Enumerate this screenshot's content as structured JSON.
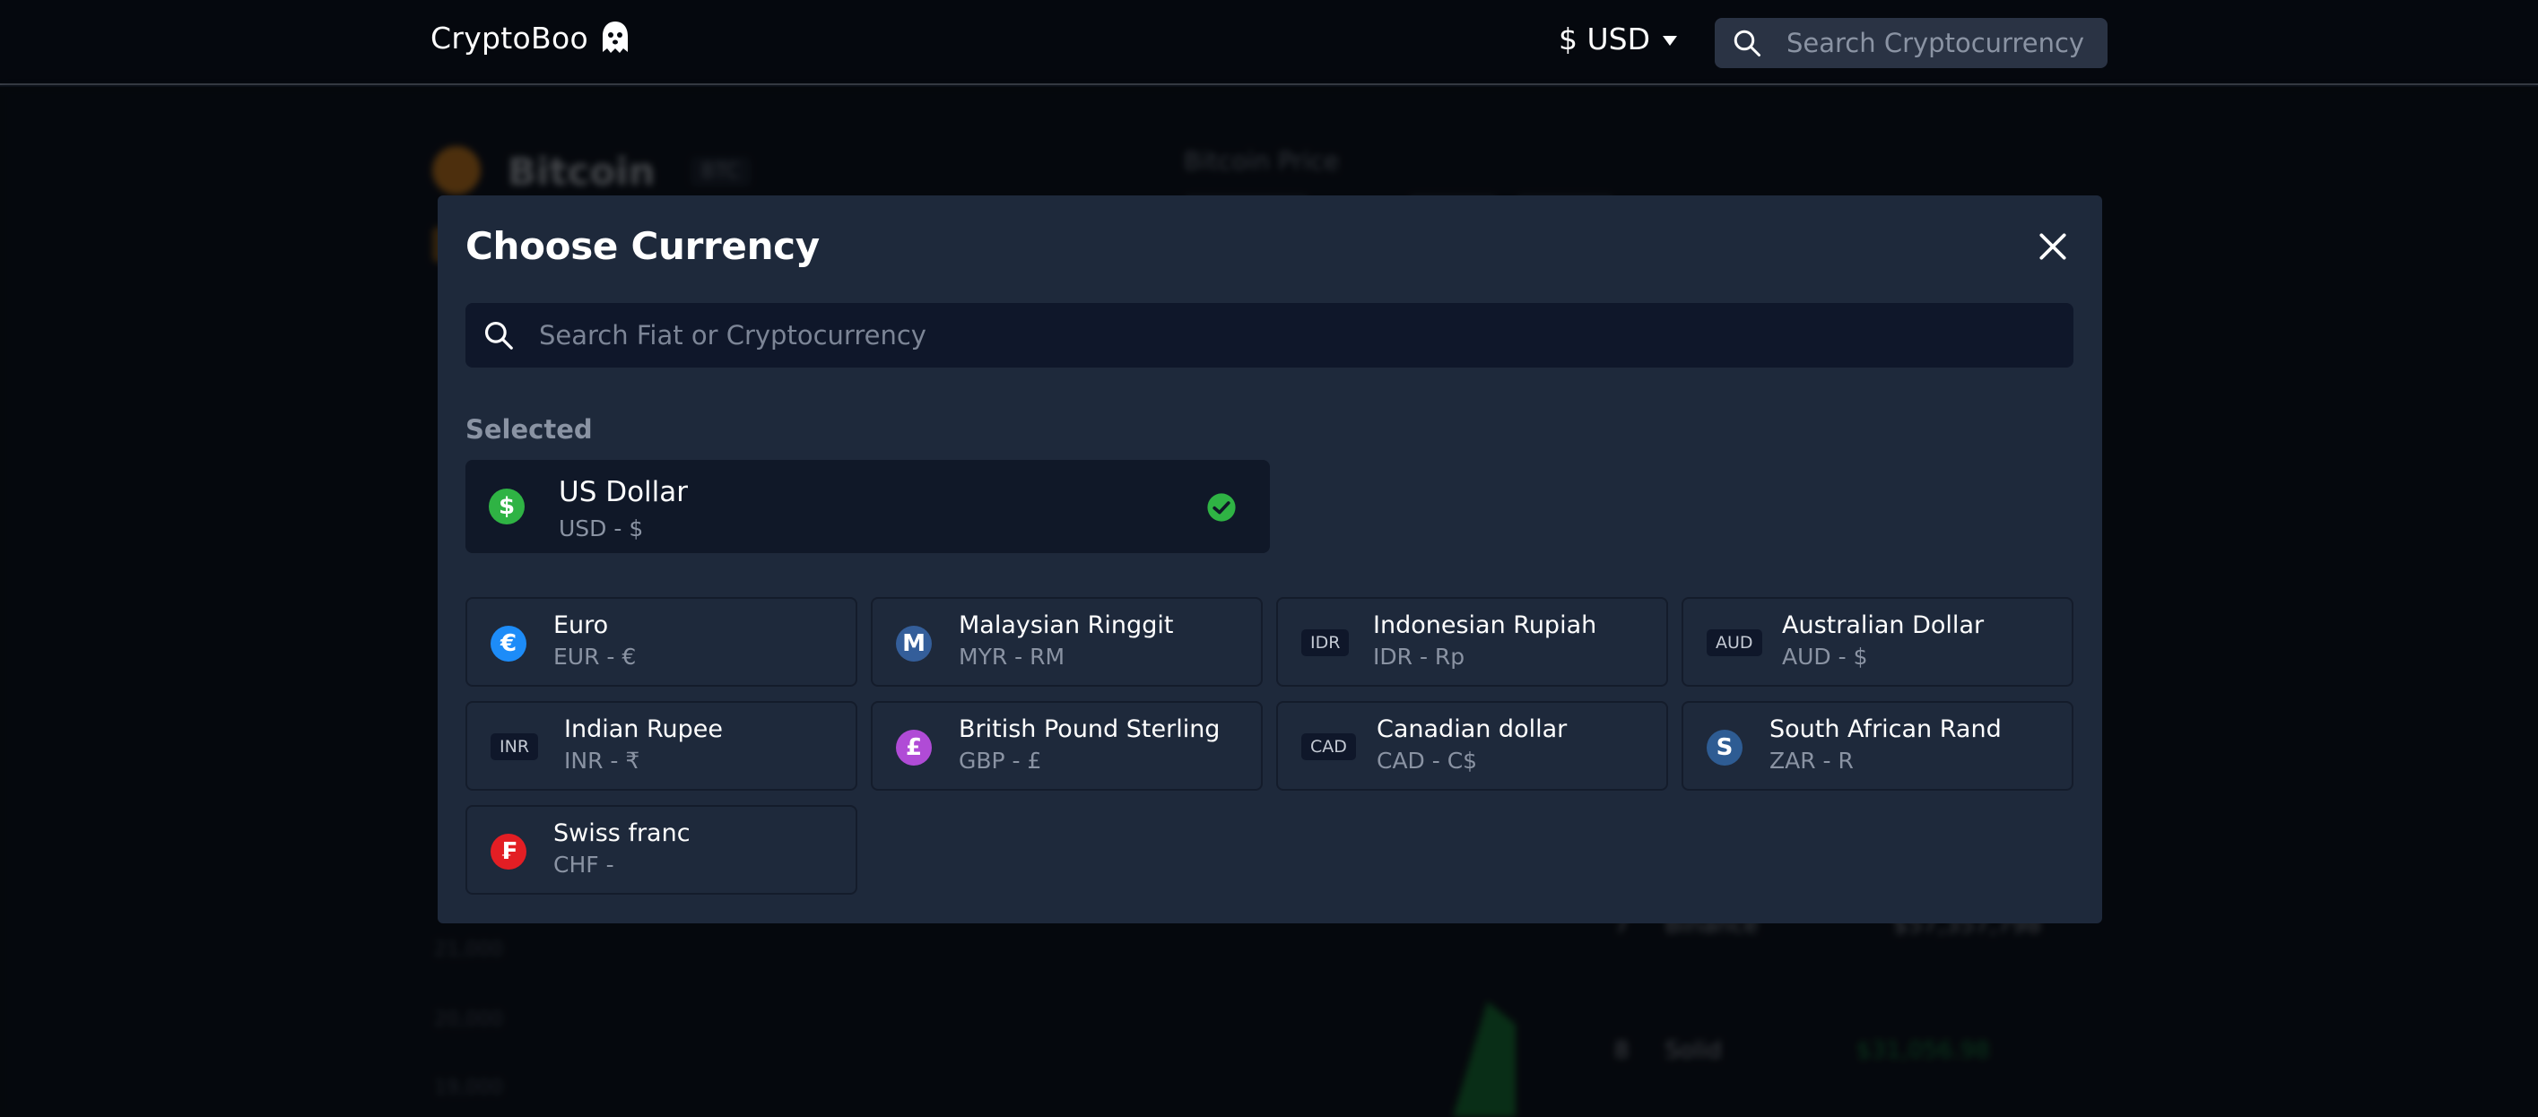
{
  "navbar": {
    "brand": "CryptoBoo",
    "currency_symbol": "$",
    "currency_code": "USD",
    "search_placeholder": "Search Cryptocurrency"
  },
  "background": {
    "coin_name": "Bitcoin",
    "coin_symbol": "BTC",
    "price_label": "Bitcoin Price",
    "axis_labels": [
      "21,000",
      "20,000",
      "19,000"
    ],
    "rank_rows": [
      {
        "rank": "7",
        "name": "Binance",
        "value": "$57,357,798"
      },
      {
        "rank": "8",
        "name": "Solid",
        "value": "$31,056.98"
      }
    ]
  },
  "modal": {
    "title": "Choose Currency",
    "search_placeholder": "Search Fiat or Cryptocurrency",
    "selected_label": "Selected",
    "selected": {
      "name": "US Dollar",
      "code": "USD - $",
      "icon_glyph": "$",
      "icon_color": "#2fb344",
      "check_color": "#2fb344"
    },
    "currencies": [
      {
        "name": "Euro",
        "code": "EUR - €",
        "icon_type": "circle",
        "icon_glyph": "€",
        "icon_color": "#1d8cf8"
      },
      {
        "name": "Malaysian Ringgit",
        "code": "MYR - RM",
        "icon_type": "circle",
        "icon_glyph": "M",
        "icon_color": "#345e9a"
      },
      {
        "name": "Indonesian Rupiah",
        "code": "IDR - Rp",
        "icon_type": "tag",
        "icon_glyph": "IDR"
      },
      {
        "name": "Australian Dollar",
        "code": "AUD - $",
        "icon_type": "tag",
        "icon_glyph": "AUD"
      },
      {
        "name": "Indian Rupee",
        "code": "INR - ₹",
        "icon_type": "tag",
        "icon_glyph": "INR"
      },
      {
        "name": "British Pound Sterling",
        "code": "GBP - £",
        "icon_type": "circle",
        "icon_glyph": "£",
        "icon_color": "#b04bd6"
      },
      {
        "name": "Canadian dollar",
        "code": "CAD - C$",
        "icon_type": "tag",
        "icon_glyph": "CAD"
      },
      {
        "name": "South African Rand",
        "code": "ZAR - R",
        "icon_type": "circle",
        "icon_glyph": "S",
        "icon_color": "#2e5c93"
      },
      {
        "name": "Swiss franc",
        "code": "CHF -",
        "icon_type": "circle",
        "icon_glyph": "₣",
        "icon_color": "#e31e24"
      }
    ]
  }
}
